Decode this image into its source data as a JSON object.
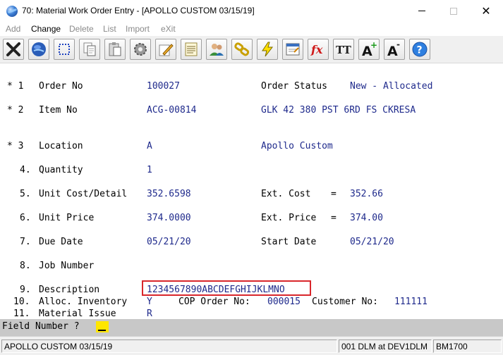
{
  "window": {
    "title": "70: Material Work Order Entry - [APOLLO CUSTOM 03/15/19]",
    "controls": {
      "minimize": "—",
      "maximize": "□",
      "close": "✕"
    }
  },
  "menu": {
    "items": [
      {
        "label": "Add",
        "enabled": false
      },
      {
        "label": "Change",
        "enabled": true
      },
      {
        "label": "Delete",
        "enabled": false
      },
      {
        "label": "List",
        "enabled": false
      },
      {
        "label": "Import",
        "enabled": false
      },
      {
        "label": "eXit",
        "enabled": false
      }
    ]
  },
  "toolbar": {
    "buttons": [
      {
        "icon": "close-x-icon"
      },
      {
        "icon": "globe-icon"
      },
      {
        "icon": "select-dotted-icon"
      },
      {
        "icon": "copy-icon"
      },
      {
        "icon": "paste-icon"
      },
      {
        "icon": "gear-icon"
      },
      {
        "icon": "edit-pencil-icon"
      },
      {
        "icon": "notes-icon"
      },
      {
        "icon": "users-icon"
      },
      {
        "icon": "chain-link-icon"
      },
      {
        "icon": "lightning-icon"
      },
      {
        "icon": "window-form-icon"
      },
      {
        "icon": "function-fx-icon"
      },
      {
        "icon": "text-style-icon"
      },
      {
        "icon": "font-increase-icon"
      },
      {
        "icon": "font-decrease-icon"
      },
      {
        "icon": "help-icon"
      }
    ],
    "labels": {
      "fx": "fx",
      "tt": "TT",
      "a": "A",
      "plus": "+",
      "minus": "-",
      "help": "?"
    }
  },
  "form": {
    "order_no": {
      "mark": "* 1",
      "label": "Order No",
      "value": "100027"
    },
    "order_status": {
      "label": "Order Status",
      "value": "New - Allocated"
    },
    "item_no": {
      "mark": "* 2",
      "label": "Item No",
      "value": "ACG-00814",
      "desc": "GLK 42 380 PST 6RD FS CKRESA"
    },
    "location": {
      "mark": "* 3",
      "label": "Location",
      "value": "A",
      "desc": "Apollo Custom"
    },
    "quantity": {
      "mark": "4.",
      "label": "Quantity",
      "value": "1"
    },
    "unit_cost": {
      "mark": "5.",
      "label": "Unit Cost/Detail",
      "value": "352.6598"
    },
    "ext_cost": {
      "label": "Ext. Cost",
      "eq": "=",
      "value": "352.66"
    },
    "unit_price": {
      "mark": "6.",
      "label": "Unit Price",
      "value": "374.0000"
    },
    "ext_price": {
      "label": "Ext. Price",
      "eq": "=",
      "value": "374.00"
    },
    "due_date": {
      "mark": "7.",
      "label": "Due Date",
      "value": "05/21/20"
    },
    "start_date": {
      "label": "Start Date",
      "value": "05/21/20"
    },
    "job_number": {
      "mark": "8.",
      "label": "Job Number",
      "value": ""
    },
    "description": {
      "mark": "9.",
      "label": "Description",
      "value": "1234567890ABCDEFGHIJKLMNO"
    },
    "alloc_inventory": {
      "mark": "10.",
      "label": "Alloc. Inventory",
      "value": "Y"
    },
    "cop_order": {
      "label": "COP Order No:",
      "value": "000015"
    },
    "customer": {
      "label": "Customer No:",
      "value": "111111"
    },
    "material_issue": {
      "mark": "11.",
      "label": "Material Issue",
      "value": "R"
    }
  },
  "prompt": {
    "text": "Field Number ?"
  },
  "statusbar": {
    "company": "APOLLO CUSTOM 03/15/19",
    "session": "001 DLM at DEV1DLM",
    "code": "BM1700"
  },
  "colors": {
    "value_text": "#1f2a8c",
    "highlight_box": "#d9262b",
    "cursor": "#ffe600",
    "prompt_bg": "#c8c8c8"
  }
}
